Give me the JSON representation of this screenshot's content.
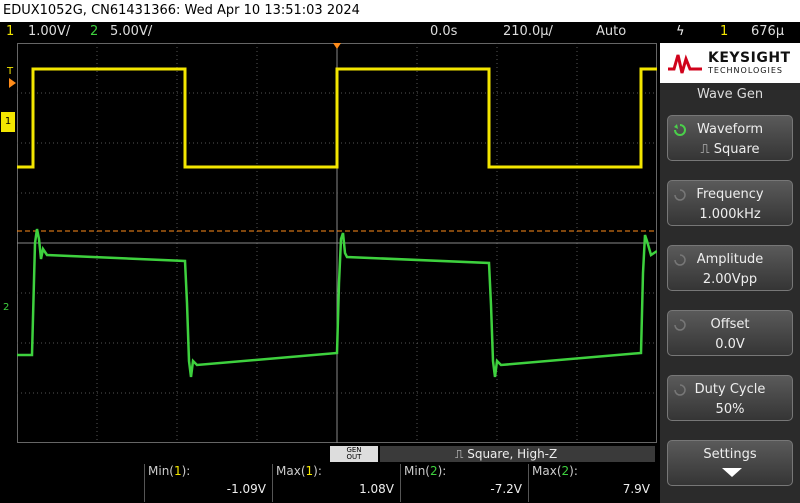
{
  "title": "EDUX1052G, CN61431366: Wed Apr 10 13:51:03 2024",
  "status": {
    "ch1_num": "1",
    "ch1_scale": "1.00V/",
    "ch2_num": "2",
    "ch2_scale": "5.00V/",
    "delay": "0.0s",
    "timebase": "210.0µ/",
    "trigger_mode": "Auto",
    "trigger_icon": "trigger-rising-edge-icon",
    "trigger_src": "1",
    "trigger_level": "676µ"
  },
  "grid_markers": {
    "trigger_T": "T",
    "ch1_marker": "1",
    "ch2_marker": "2"
  },
  "brand": {
    "name": "KEYSIGHT",
    "sub": "TECHNOLOGIES"
  },
  "menu": {
    "title": "Wave Gen",
    "softkeys": [
      {
        "label": "Waveform",
        "value": "⎍ Square"
      },
      {
        "label": "Frequency",
        "value": "1.000kHz"
      },
      {
        "label": "Amplitude",
        "value": "2.00Vpp"
      },
      {
        "label": "Offset",
        "value": "0.0V"
      },
      {
        "label": "Duty Cycle",
        "value": "50%"
      },
      {
        "label": "Settings",
        "value": ""
      }
    ]
  },
  "gen": {
    "out_label_1": "GEN",
    "out_label_2": "OUT",
    "status": "⎍ Square, High-Z"
  },
  "measurements": [
    {
      "label": "Min",
      "ch": "1",
      "value": "-1.09V"
    },
    {
      "label": "Max",
      "ch": "1",
      "value": "1.08V"
    },
    {
      "label": "Min",
      "ch": "2",
      "value": "-7.2V"
    },
    {
      "label": "Max",
      "ch": "2",
      "value": "7.9V"
    }
  ],
  "colors": {
    "ch1": "#f3e600",
    "ch2": "#3ed13e",
    "trigger": "#ff8c1a",
    "grid": "#555555"
  }
}
